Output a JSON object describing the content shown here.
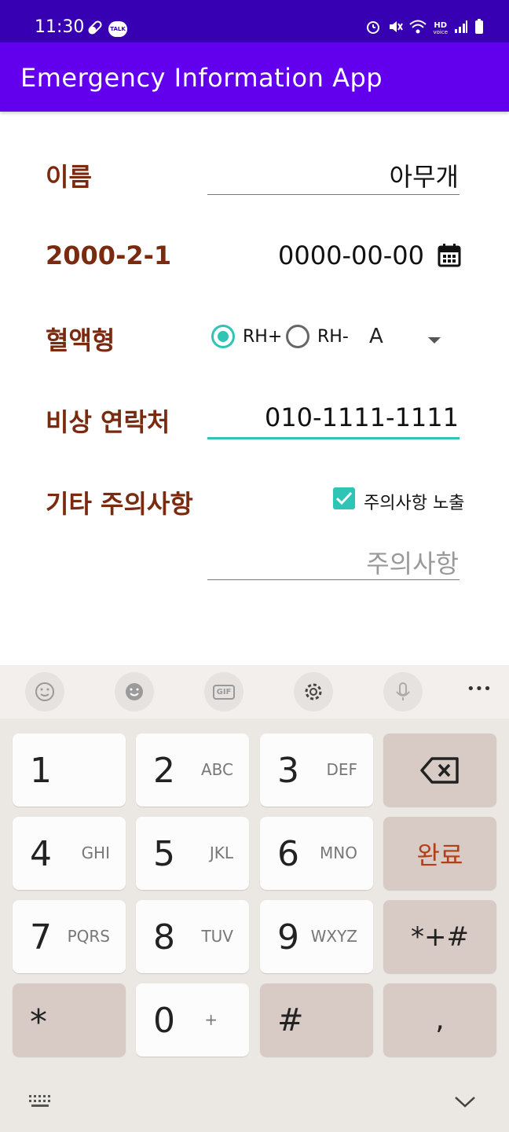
{
  "status": {
    "time": "11:30",
    "hd_label": "HD",
    "voice_label": "voice",
    "talk_badge": "TALK"
  },
  "app_bar": {
    "title": "Emergency Information App"
  },
  "form": {
    "name": {
      "label": "이름",
      "value": "아무개"
    },
    "birth": {
      "label": "2000-2-1",
      "value": "0000-00-00"
    },
    "blood": {
      "label": "혈액형",
      "rh_plus": "RH+",
      "rh_minus": "RH-",
      "selected_rh": "RH+",
      "type_value": "A"
    },
    "contact": {
      "label": "비상 연락처",
      "value": "010-1111-1111"
    },
    "notes": {
      "label": "기타 주의사항",
      "checkbox_label": "주의사항 노출",
      "checked": true,
      "placeholder": "주의사항"
    }
  },
  "keyboard": {
    "toolbar": [
      "emoji-icon",
      "sticker-icon",
      "gif-icon",
      "settings-icon",
      "mic-icon",
      "more-icon"
    ],
    "gif_label": "GIF",
    "more_label": "•••",
    "keys": [
      {
        "main": "1",
        "sub": ""
      },
      {
        "main": "2",
        "sub": "ABC"
      },
      {
        "main": "3",
        "sub": "DEF"
      },
      {
        "main": "4",
        "sub": "GHI"
      },
      {
        "main": "5",
        "sub": "JKL"
      },
      {
        "main": "6",
        "sub": "MNO"
      },
      {
        "main": "7",
        "sub": "PQRS"
      },
      {
        "main": "8",
        "sub": "TUV"
      },
      {
        "main": "9",
        "sub": "WXYZ"
      },
      {
        "main": "0",
        "sub": "+"
      }
    ],
    "done_label": "완료",
    "symbols_label": "*+#",
    "star_label": "*",
    "hash_label": "#",
    "comma_label": ",",
    "accent_color": "#b0401a"
  }
}
